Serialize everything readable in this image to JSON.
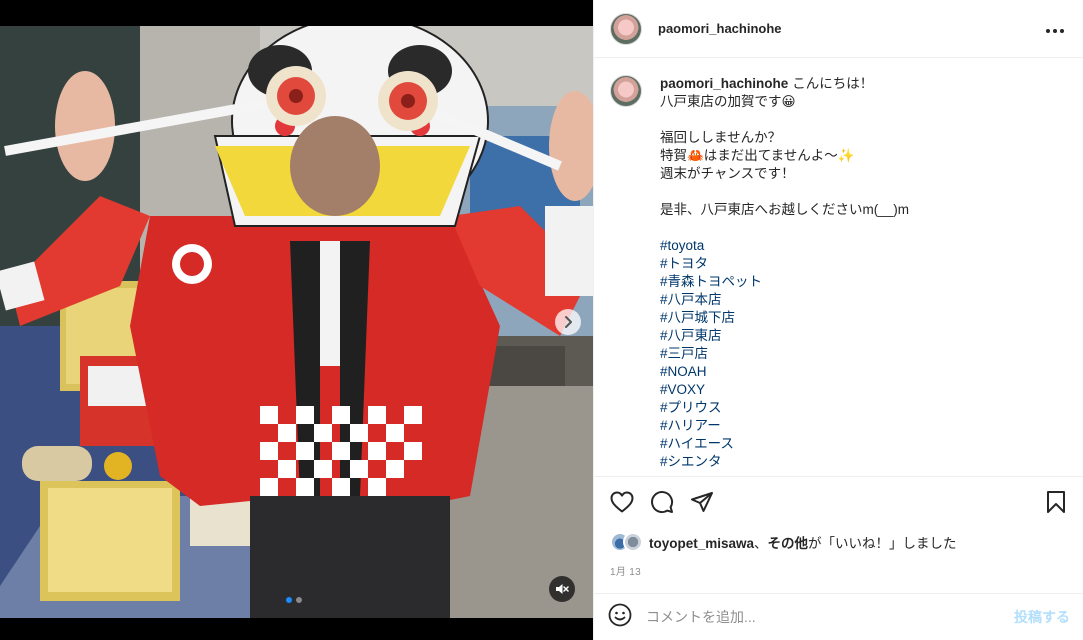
{
  "post": {
    "username": "paomori_hachinohe",
    "more_icon": "more-horizontal-icon",
    "caption_lines": [
      "こんにちは！",
      "八戸東店の加賀です😀",
      "",
      "福回ししませんか？",
      "特賀🦀はまだ出てませんよ〜✨",
      "週末がチャンスです！",
      "",
      "是非、八戸東店へお越しくださいm(__)m",
      ""
    ],
    "hashtags": [
      "#toyota",
      "#トヨタ",
      "#青森トヨペット",
      "#八戸本店",
      "#八戸城下店",
      "#八戸東店",
      "#三戸店",
      "#NOAH",
      "#VOXY",
      "#プリウス",
      "#ハリアー",
      "#ハイエース",
      "#シエンタ"
    ]
  },
  "media": {
    "carousel_total": 2,
    "carousel_active": 1,
    "next_icon": "chevron-right-icon",
    "mute_icon": "speaker-muted-icon"
  },
  "actions": {
    "like_icon": "heart-icon",
    "comment_icon": "comment-icon",
    "share_icon": "send-icon",
    "save_icon": "bookmark-icon"
  },
  "likes": {
    "user": "toyopet_misawa",
    "separator": "、",
    "others": "その他",
    "suffix": "が「いいね！」しました"
  },
  "date": "1月 13",
  "comment_box": {
    "emoji_icon": "emoji-icon",
    "placeholder": "コメントを追加...",
    "post_label": "投稿する"
  },
  "colors": {
    "link": "#00376b",
    "post_disabled": "#b2dffc",
    "carousel_active_dot": "#1a8cff"
  }
}
